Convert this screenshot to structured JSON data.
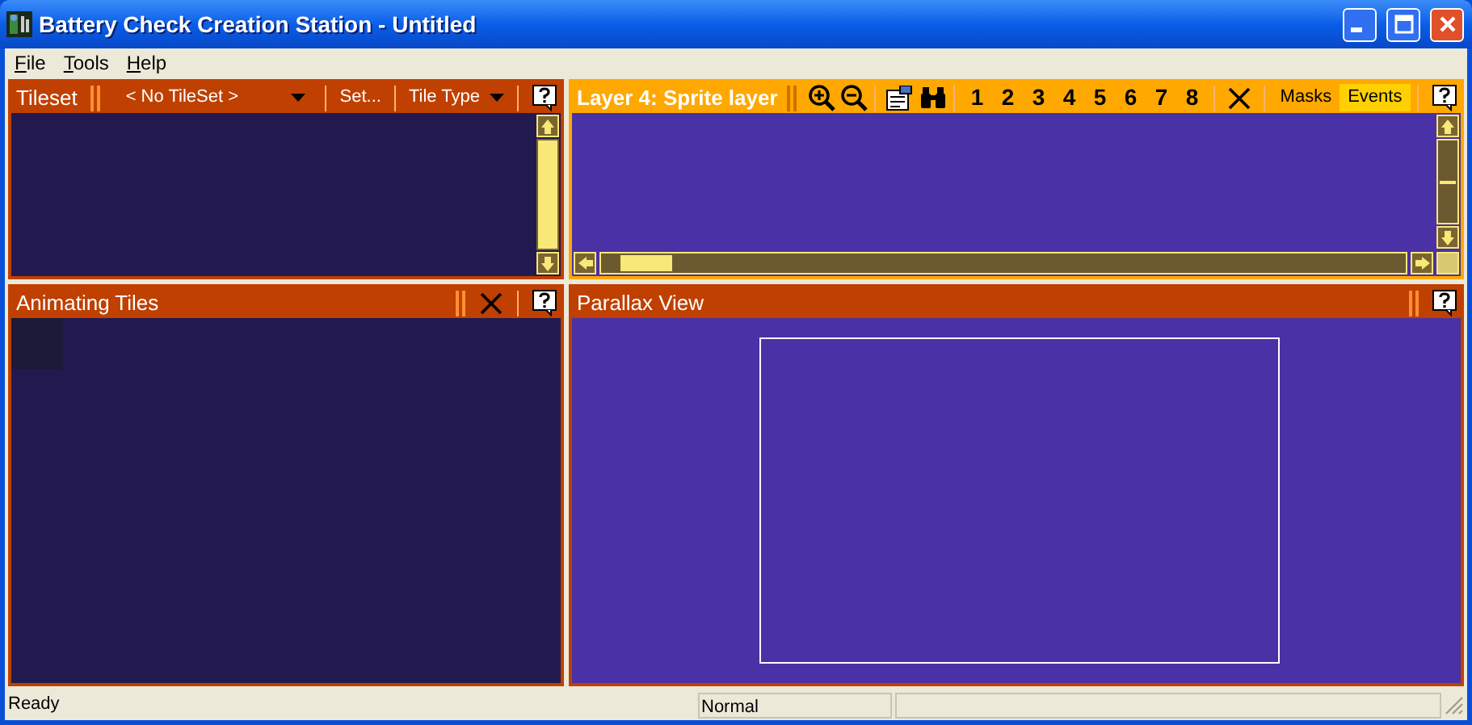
{
  "window": {
    "title": "Battery Check Creation Station - Untitled"
  },
  "menu": [
    "File",
    "Tools",
    "Help"
  ],
  "tileset_panel": {
    "title": "Tileset",
    "tileset_dropdown": "< No TileSet >",
    "set_button": "Set...",
    "tile_type_dropdown": "Tile Type"
  },
  "layer_panel": {
    "title": "Layer 4: Sprite layer",
    "layer_buttons": [
      "1",
      "2",
      "3",
      "4",
      "5",
      "6",
      "7",
      "8"
    ],
    "toggles": [
      {
        "label": "Masks",
        "selected": false
      },
      {
        "label": "Events",
        "selected": true
      }
    ]
  },
  "animating_panel": {
    "title": "Animating Tiles"
  },
  "parallax_panel": {
    "title": "Parallax View"
  },
  "status_bar": [
    "Ready",
    "Normal"
  ]
}
